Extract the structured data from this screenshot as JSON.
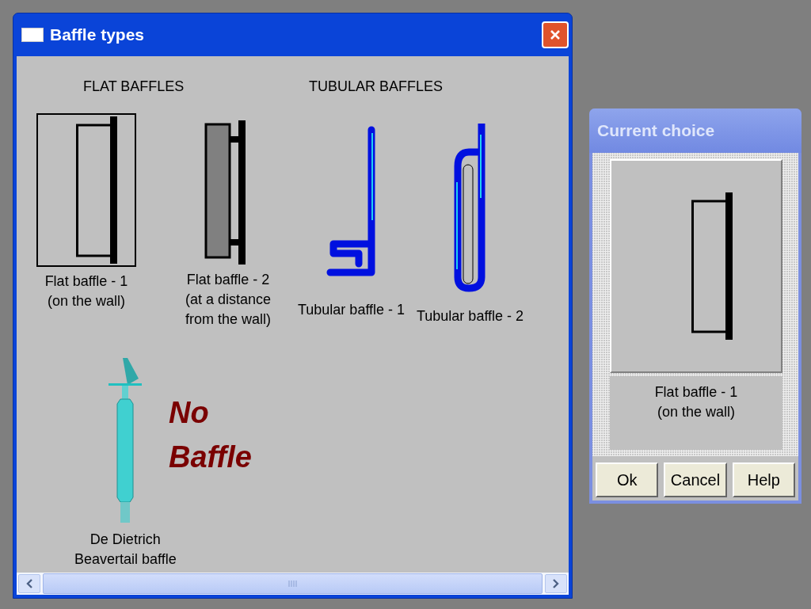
{
  "main_window": {
    "title": "Baffle types",
    "headings": [
      {
        "text": "FLAT BAFFLES"
      },
      {
        "text": "TUBULAR BAFFLES"
      }
    ],
    "items": [
      {
        "kind": "flat1",
        "label": "Flat baffle - 1\n(on the wall)",
        "selected": true
      },
      {
        "kind": "flat2",
        "label": "Flat baffle - 2\n(at a distance\nfrom the wall)",
        "selected": false
      },
      {
        "kind": "tube1",
        "label": "Tubular baffle - 1",
        "selected": false
      },
      {
        "kind": "tube2",
        "label": "Tubular baffle - 2",
        "selected": false
      },
      {
        "kind": "dietrich",
        "label": "De Dietrich\nBeavertail baffle",
        "selected": false
      },
      {
        "kind": "none",
        "label": "No\nBaffle",
        "selected": false
      }
    ]
  },
  "choice_window": {
    "title": "Current choice",
    "caption": "Flat baffle - 1\n(on the wall)",
    "buttons": [
      "Ok",
      "Cancel",
      "Help"
    ]
  }
}
